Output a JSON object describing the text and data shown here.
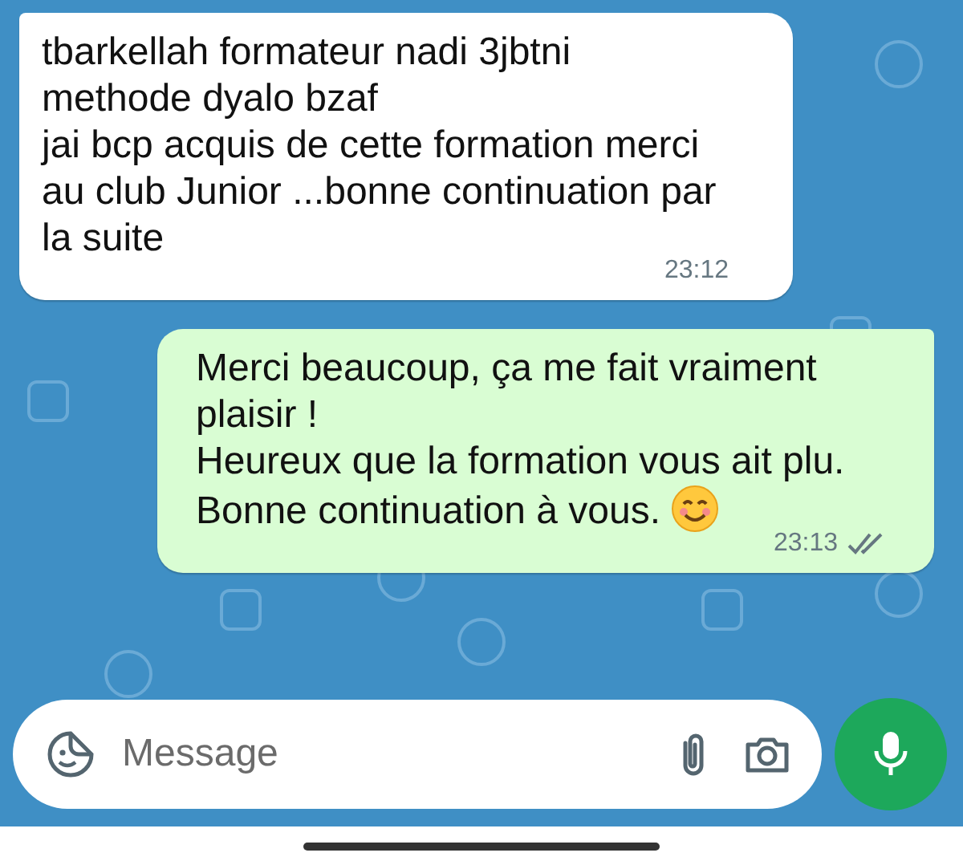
{
  "messages": [
    {
      "kind": "incoming",
      "paragraphs": [
        "tbarkellah formateur nadi 3jbtni methode dyalo bzaf",
        "jai bcp acquis de cette formation merci au club Junior ...bonne continuation par la suite"
      ],
      "time": "23:12"
    },
    {
      "kind": "outgoing",
      "paragraphs": [
        "Merci beaucoup, ça me fait vraiment plaisir !",
        "Heureux que la formation vous ait plu.",
        "Bonne continuation à vous."
      ],
      "time": "23:13",
      "read": false
    }
  ],
  "composer": {
    "placeholder": "Message"
  }
}
